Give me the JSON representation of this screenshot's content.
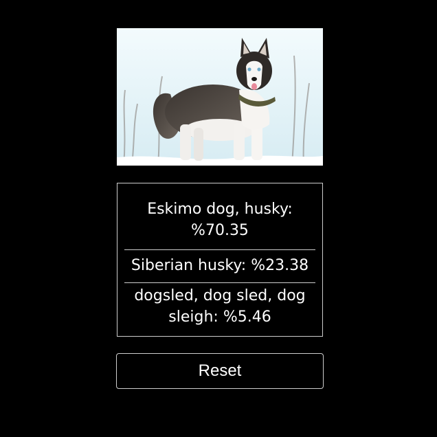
{
  "image": {
    "subject": "husky-dog-photo"
  },
  "predictions": [
    {
      "text": "Eskimo dog, husky: %70.35"
    },
    {
      "text": "Siberian husky: %23.38"
    },
    {
      "text": "dogsled, dog sled, dog sleigh: %5.46"
    }
  ],
  "actions": {
    "reset_label": "Reset"
  },
  "colors": {
    "background": "#000000",
    "text": "#ffffff",
    "border": "#cfcfcf"
  }
}
